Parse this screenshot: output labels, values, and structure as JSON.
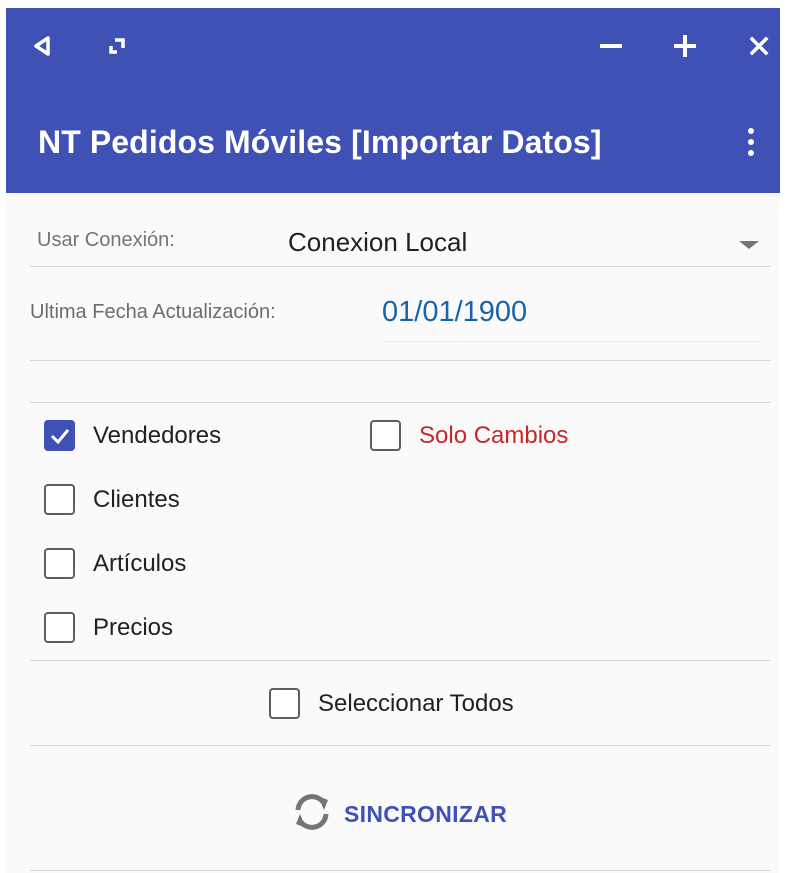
{
  "window_controls": {
    "back_icon": "back-triangle-icon",
    "restore_icon": "restore-window-icon",
    "minimize_icon": "minimize-icon",
    "maximize_icon": "plus-icon",
    "close_icon": "close-icon"
  },
  "app_bar": {
    "title": "NT Pedidos Móviles [Importar Datos]",
    "menu_icon": "overflow-menu-icon"
  },
  "connection": {
    "label": "Usar Conexión:",
    "selected": "Conexion Local"
  },
  "last_update": {
    "label": "Ultima Fecha Actualización:",
    "value": "01/01/1900"
  },
  "options": [
    {
      "label": "Vendedores",
      "checked": true
    },
    {
      "label": "Clientes",
      "checked": false
    },
    {
      "label": "Artículos",
      "checked": false
    },
    {
      "label": "Precios",
      "checked": false
    }
  ],
  "solo_cambios": {
    "label": "Solo Cambios",
    "checked": false
  },
  "select_all": {
    "label": "Seleccionar Todos",
    "checked": false
  },
  "sync": {
    "label": "SINCRONIZAR",
    "icon": "sync-icon"
  },
  "colors": {
    "primary": "#3f51b5",
    "date_value": "#1b63a8",
    "solo_cambios": "#c62828"
  }
}
